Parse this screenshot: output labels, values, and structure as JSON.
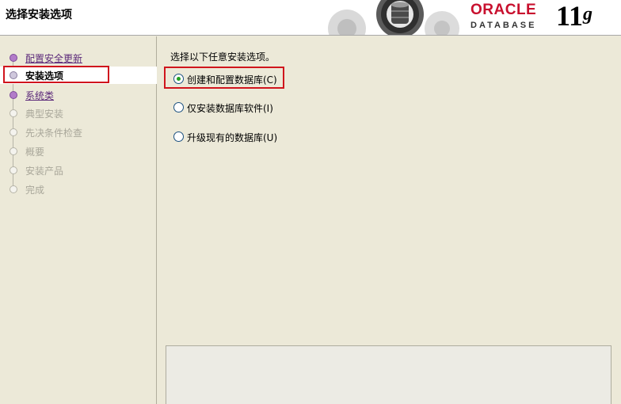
{
  "header": {
    "title": "选择安装选项",
    "brand_top": "ORACLE",
    "brand_bottom": "DATABASE",
    "version_num": "11",
    "version_letter": "g"
  },
  "sidebar": {
    "steps": [
      {
        "label": "配置安全更新",
        "state": "done"
      },
      {
        "label": "安装选项",
        "state": "current"
      },
      {
        "label": "系统类",
        "state": "link"
      },
      {
        "label": "典型安装",
        "state": "disabled"
      },
      {
        "label": "先决条件检查",
        "state": "disabled"
      },
      {
        "label": "概要",
        "state": "disabled"
      },
      {
        "label": "安装产品",
        "state": "disabled"
      },
      {
        "label": "完成",
        "state": "disabled"
      }
    ]
  },
  "main": {
    "prompt": "选择以下任意安装选项。",
    "options": [
      {
        "label": "创建和配置数据库(C)",
        "checked": true
      },
      {
        "label": "仅安装数据库软件(I)",
        "checked": false
      },
      {
        "label": "升级现有的数据库(U)",
        "checked": false
      }
    ]
  },
  "colors": {
    "accent_red": "#d0151d",
    "oracle_red": "#c8102e",
    "link_purple": "#5c2a7a"
  }
}
